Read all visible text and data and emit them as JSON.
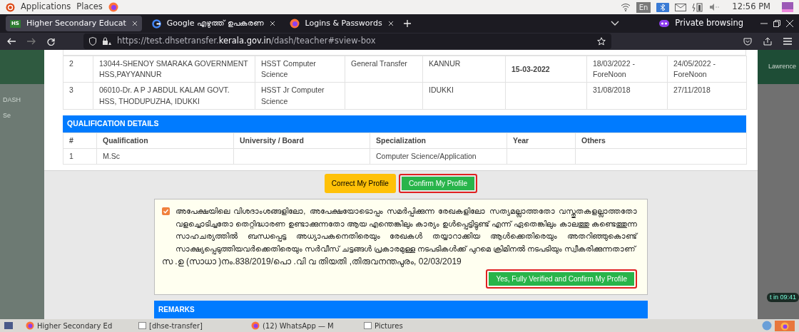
{
  "system_bar": {
    "menus": [
      "Applications",
      "Places"
    ],
    "input_method": "En",
    "clock": "12:56 PM"
  },
  "browser": {
    "tabs": [
      {
        "label": "Higher Secondary Educat",
        "badge": "HS",
        "kind": "site",
        "selected": true
      },
      {
        "label": "Google എഴുത്ത് ഉപകരണ",
        "kind": "google",
        "selected": false
      },
      {
        "label": "Logins & Passwords",
        "kind": "firefox",
        "selected": false
      }
    ],
    "private_label": "Private browsing",
    "url": {
      "prefix": "https://test.dhsetransfer.",
      "domain": "kerala.gov.in",
      "path": "/dash/teacher#sview-box"
    }
  },
  "background_page": {
    "left_texts": [
      "DASH",
      "Se"
    ],
    "right_texts": [
      "Lawrence",
      "t in 09:41"
    ]
  },
  "transfer_table": {
    "rows": [
      {
        "cells": [
          "2",
          "13044-SHENOY SMARAKA GOVERNMENT HSS,PAYYANNUR",
          "HSST Computer Science",
          "General Transfer",
          "KANNUR",
          "15-03-2022",
          "18/03/2022 - ForeNoon",
          "24/05/2022 - ForeNoon"
        ]
      },
      {
        "cells": [
          "3",
          "06010-Dr. A P J ABDUL KALAM GOVT. HSS, THODUPUZHA, IDUKKI",
          "HSST Jr Computer Science",
          null,
          "IDUKKI",
          null,
          "31/08/2018",
          "27/11/2018"
        ]
      }
    ]
  },
  "qualification": {
    "title": "QUALIFICATION DETAILS",
    "columns": [
      "#",
      "Qualification",
      "University / Board",
      "Specialization",
      "Year",
      "Others"
    ],
    "rows": [
      {
        "cells": [
          "1",
          "M.Sc",
          null,
          "Computer Science/Application",
          null,
          null
        ]
      }
    ]
  },
  "actions": [
    {
      "label": "Correct My Profile",
      "kind": "warning",
      "highlighted": false
    },
    {
      "label": "Confirm My Profile",
      "kind": "success",
      "highlighted": true
    }
  ],
  "declaration": {
    "checked": true,
    "text": "അപേക്ഷയിലെ വിശദാംശങ്ങളിലോ, അപേക്ഷയോടൊപ്പം സമർപ്പിക്കുന്ന രേഖകളിലോ സത്യമല്ലാത്തതോ വസ്തുതകളല്ലാത്തതോ വളച്ചൊടിച്ചതോ തെറ്റിദ്ധാരണ ഉണ്ടാക്കുന്നതോ ആയ എന്തെങ്കിലും കാര്യം ഉൾപ്പെട്ടിട്ടുണ്ട് എന്ന് ഏതെങ്കിലും കാലത്തു കണ്ടെത്തുന്ന സാഹചര്യത്തിൽ ബന്ധപ്പെട്ട അധ്യാപകനെതിരെയും രേഖകൾ തയ്യാറാക്കിയ ആൾക്കെതിരെയും അതറിഞ്ഞുകൊണ്ട് സാക്ഷ്യപ്പെടുത്തിയവർക്കെതിരെയും സർവീസ് ചട്ടങ്ങൾ പ്രകാരമുള്ള നടപടികൾക്ക് പുറമെ ക്രിമിനൽ നടപടിയും സ്വീകരിക്കുന്നതാണ്",
    "reference": "സ .ഉ (സാധാ )നം.838/2019/പൊ .വി വ തിയതി ,തിരുവനന്തപുരം, 02/03/2019",
    "button": {
      "label": "Yes, Fully Verified and Confirm My Profile",
      "highlighted": true
    }
  },
  "remarks": {
    "title": "REMARKS"
  },
  "taskbar": {
    "items": [
      {
        "label": "Higher Secondary Ed",
        "kind": "firefox"
      },
      {
        "label": "[dhse-transfer]",
        "kind": "window"
      },
      {
        "label": "(12) WhatsApp — M",
        "kind": "firefox"
      },
      {
        "label": "Pictures",
        "kind": "window"
      }
    ]
  }
}
